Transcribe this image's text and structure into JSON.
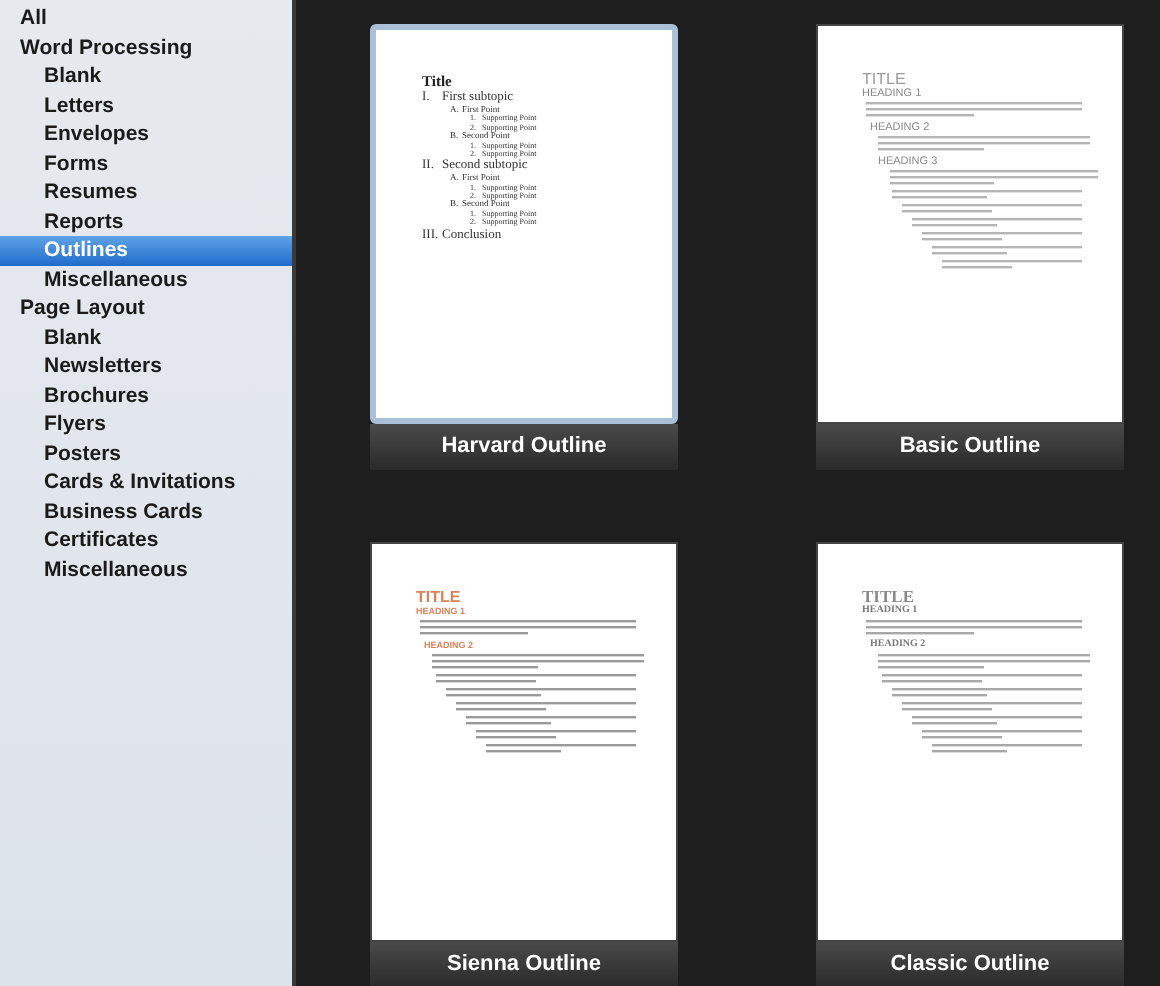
{
  "sidebar": {
    "items": [
      {
        "label": "All",
        "selected": false
      },
      {
        "label": "Word Processing",
        "selected": false,
        "children": [
          {
            "label": "Blank",
            "selected": false
          },
          {
            "label": "Letters",
            "selected": false
          },
          {
            "label": "Envelopes",
            "selected": false
          },
          {
            "label": "Forms",
            "selected": false
          },
          {
            "label": "Resumes",
            "selected": false
          },
          {
            "label": "Reports",
            "selected": false
          },
          {
            "label": "Outlines",
            "selected": true
          },
          {
            "label": "Miscellaneous",
            "selected": false
          }
        ]
      },
      {
        "label": "Page Layout",
        "selected": false,
        "children": [
          {
            "label": "Blank",
            "selected": false
          },
          {
            "label": "Newsletters",
            "selected": false
          },
          {
            "label": "Brochures",
            "selected": false
          },
          {
            "label": "Flyers",
            "selected": false
          },
          {
            "label": "Posters",
            "selected": false
          },
          {
            "label": "Cards & Invitations",
            "selected": false
          },
          {
            "label": "Business Cards",
            "selected": false
          },
          {
            "label": "Certificates",
            "selected": false
          },
          {
            "label": "Miscellaneous",
            "selected": false
          }
        ]
      }
    ]
  },
  "templates": [
    {
      "name": "Harvard Outline",
      "selected": true,
      "document": {
        "kind": "harvard",
        "title": "Title",
        "outline": [
          {
            "marker": "I.",
            "text": "First subtopic",
            "children": [
              {
                "marker": "A.",
                "text": "First Point",
                "children": [
                  {
                    "marker": "1.",
                    "text": "Supporting Point"
                  },
                  {
                    "marker": "2.",
                    "text": "Supporting Point"
                  }
                ]
              },
              {
                "marker": "B.",
                "text": "Second Point",
                "children": [
                  {
                    "marker": "1.",
                    "text": "Supporting Point"
                  },
                  {
                    "marker": "2.",
                    "text": "Supporting Point"
                  }
                ]
              }
            ]
          },
          {
            "marker": "II.",
            "text": "Second subtopic",
            "children": [
              {
                "marker": "A.",
                "text": "First Point",
                "children": [
                  {
                    "marker": "1.",
                    "text": "Supporting Point"
                  },
                  {
                    "marker": "2.",
                    "text": "Supporting Point"
                  }
                ]
              },
              {
                "marker": "B.",
                "text": "Second Point",
                "children": [
                  {
                    "marker": "1.",
                    "text": "Supporting Point"
                  },
                  {
                    "marker": "2.",
                    "text": "Supporting Point"
                  }
                ]
              }
            ]
          },
          {
            "marker": "III.",
            "text": "Conclusion"
          }
        ]
      }
    },
    {
      "name": "Basic Outline",
      "selected": false,
      "document": {
        "kind": "basic",
        "title": "TITLE",
        "headings": [
          "HEADING 1",
          "HEADING 2",
          "HEADING 3"
        ]
      }
    },
    {
      "name": "Sienna Outline",
      "selected": false,
      "document": {
        "kind": "sienna",
        "title": "TITLE",
        "headings": [
          "HEADING 1",
          "HEADING 2"
        ]
      }
    },
    {
      "name": "Classic Outline",
      "selected": false,
      "document": {
        "kind": "classic",
        "title": "TITLE",
        "headings": [
          "HEADING 1",
          "HEADING 2"
        ]
      }
    }
  ]
}
